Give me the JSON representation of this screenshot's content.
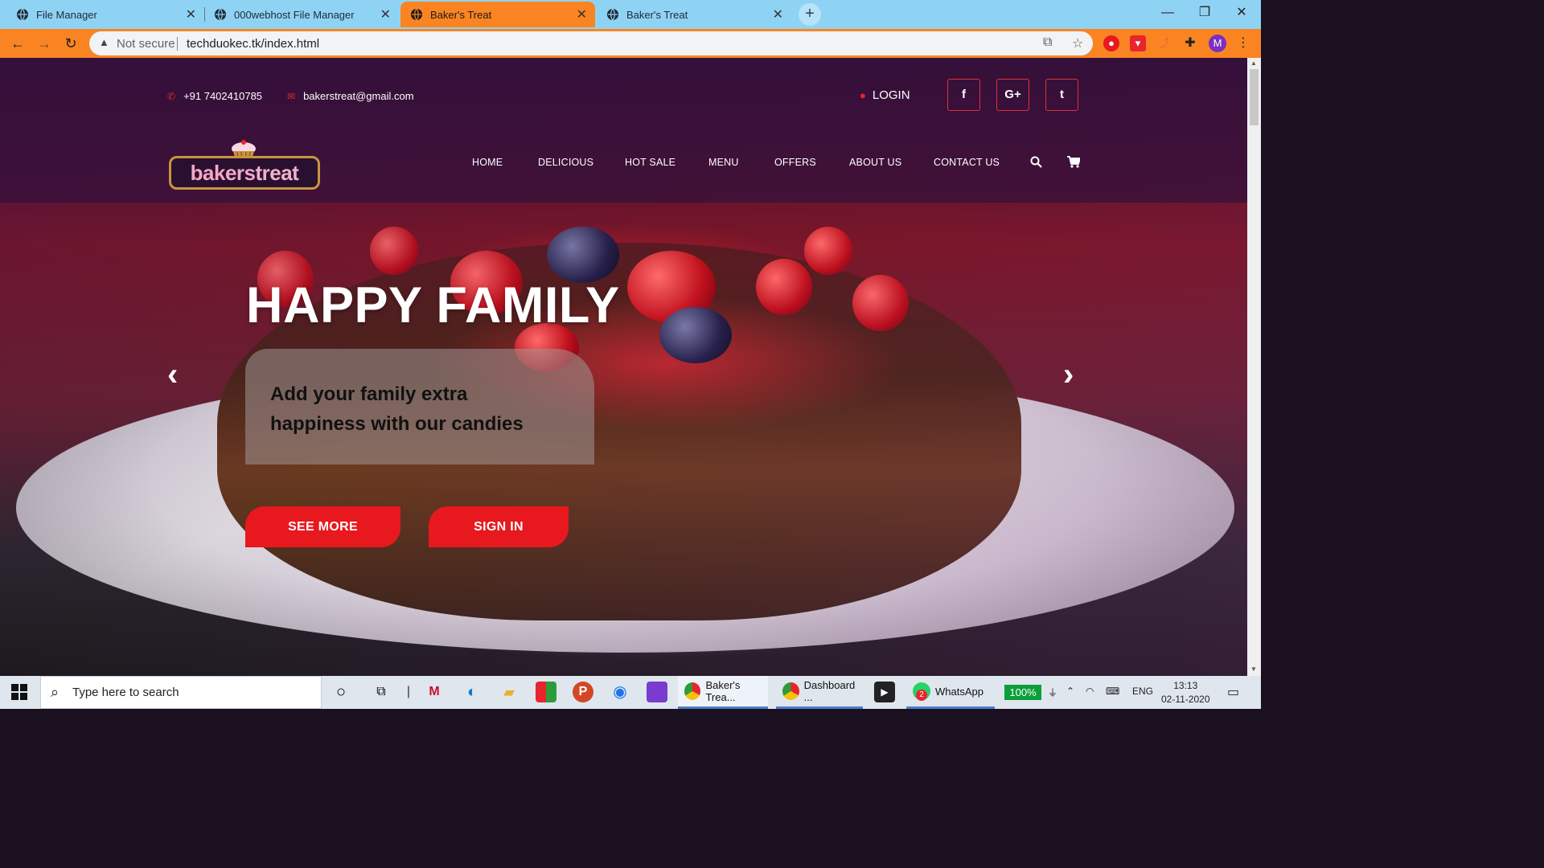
{
  "browser": {
    "tabs": [
      {
        "title": "File Manager",
        "active": false
      },
      {
        "title": "000webhost File Manager",
        "active": false
      },
      {
        "title": "Baker's Treat",
        "active": true
      },
      {
        "title": "Baker's Treat",
        "active": false
      }
    ],
    "new_tab_label": "+",
    "security_label": "Not secure",
    "url": "techduokec.tk/index.html",
    "profile_initial": "M",
    "colors": {
      "tab_bar": "#8fd3f4",
      "active_tab": "#fb8422",
      "toolbar": "#fb8422"
    }
  },
  "site": {
    "phone": "+91 7402410785",
    "email": "bakerstreat@gmail.com",
    "login_label": "LOGIN",
    "social": [
      {
        "icon": "facebook-icon",
        "glyph": "f"
      },
      {
        "icon": "google-plus-icon",
        "glyph": "G+"
      },
      {
        "icon": "twitter-icon",
        "glyph": "t"
      }
    ],
    "logo": {
      "part1": "bakers",
      "part2": "treat"
    },
    "nav": [
      "HOME",
      "DELICIOUS",
      "HOT SALE",
      "MENU",
      "OFFERS",
      "ABOUT US",
      "CONTACT US"
    ],
    "hero": {
      "headline": "HAPPY FAMILY",
      "caption": "Add your family extra happiness with our candies",
      "primary_button": "SEE MORE",
      "secondary_button": "SIGN IN",
      "prev_arrow": "‹",
      "next_arrow": "›"
    },
    "colors": {
      "accent": "#e8181f",
      "header_overlay": "#32103c",
      "logo_border": "#c7943f"
    }
  },
  "taskbar": {
    "search_placeholder": "Type here to search",
    "apps": [
      {
        "label": "Baker's Trea...",
        "active": true
      },
      {
        "label": "Dashboard ...",
        "active": false
      },
      {
        "label": "WhatsApp",
        "active": false,
        "badge": "2"
      }
    ],
    "battery": "100%",
    "language": "ENG",
    "time": "13:13",
    "date": "02-11-2020"
  }
}
